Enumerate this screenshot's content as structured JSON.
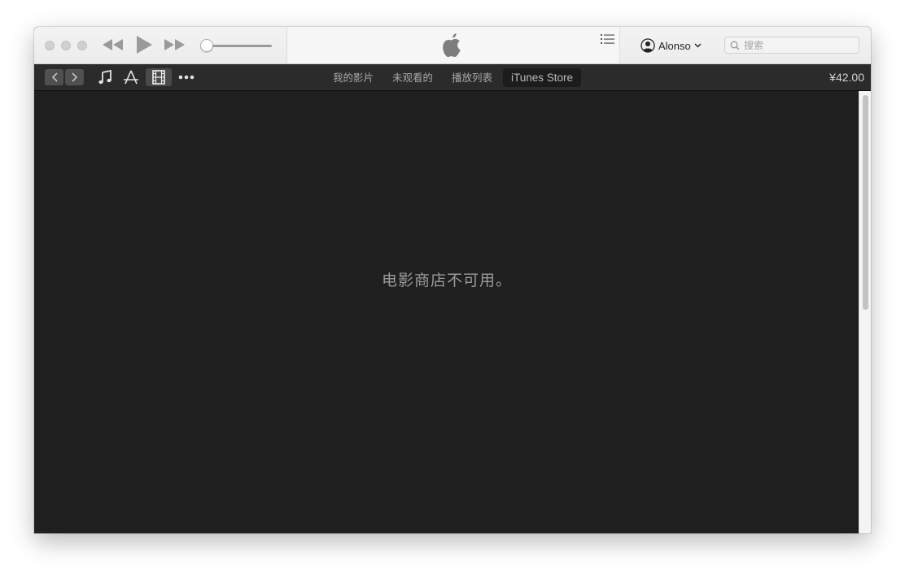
{
  "titlebar": {
    "account_name": "Alonso",
    "search_placeholder": "搜索",
    "icons": {
      "close": "close-light",
      "minimize": "minimize-light",
      "zoom": "zoom-light",
      "rewind": "rewind-icon",
      "play": "play-icon",
      "fastforward": "fast-forward-icon",
      "logo": "apple-logo",
      "upnext": "list-icon",
      "account": "person-circle-icon",
      "search": "magnifier-icon"
    }
  },
  "navbar": {
    "media_icons": [
      "music-note-icon",
      "app-store-icon",
      "film-icon",
      "more-icon"
    ],
    "active_media": "film-icon",
    "tabs": [
      {
        "label": "我的影片"
      },
      {
        "label": "未观看的"
      },
      {
        "label": "播放列表"
      },
      {
        "label": "iTunes Store",
        "selected": true
      }
    ],
    "balance": "¥42.00"
  },
  "content": {
    "message": "电影商店不可用。"
  },
  "colors": {
    "content_bg": "#1f1f1f",
    "navbar_bg": "#2b2b2b",
    "titlebar_bg": "#ececec",
    "message_text": "#9a9a9a"
  }
}
